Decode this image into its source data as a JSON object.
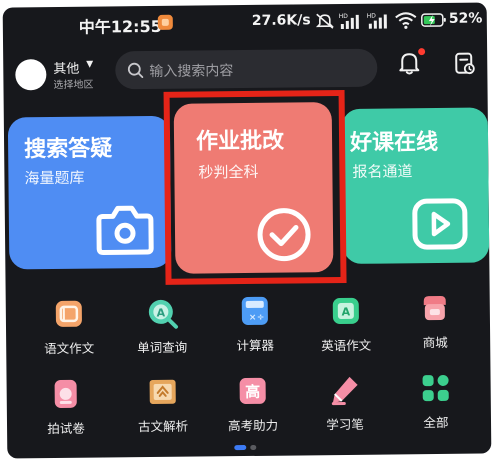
{
  "status_bar": {
    "time": "中午12:55",
    "network_speed": "27.6K/s",
    "battery_percent": "52%"
  },
  "header": {
    "region_name": "其他",
    "region_hint": "选择地区",
    "search_placeholder": "输入搜索内容"
  },
  "cards": [
    {
      "title": "搜索答疑",
      "subtitle": "海量题库",
      "icon": "camera-icon",
      "color": "#4f8df3"
    },
    {
      "title": "作业批改",
      "subtitle": "秒判全科",
      "icon": "check-circle-icon",
      "color": "#ef7b73"
    },
    {
      "title": "好课在线",
      "subtitle": "报名通道",
      "icon": "play-icon",
      "color": "#3fcaa7"
    }
  ],
  "grid": [
    {
      "label": "语文作文",
      "icon": "chinese-essay-icon"
    },
    {
      "label": "单词查询",
      "icon": "word-lookup-icon"
    },
    {
      "label": "计算器",
      "icon": "calculator-icon"
    },
    {
      "label": "英语作文",
      "icon": "english-essay-icon"
    },
    {
      "label": "商城",
      "icon": "shop-icon"
    },
    {
      "label": "拍试卷",
      "icon": "scan-paper-icon"
    },
    {
      "label": "古文解析",
      "icon": "classical-text-icon"
    },
    {
      "label": "高考助力",
      "icon": "gaokao-icon"
    },
    {
      "label": "学习笔",
      "icon": "study-pen-icon"
    },
    {
      "label": "全部",
      "icon": "all-apps-icon"
    }
  ],
  "highlight_color": "#e52418"
}
